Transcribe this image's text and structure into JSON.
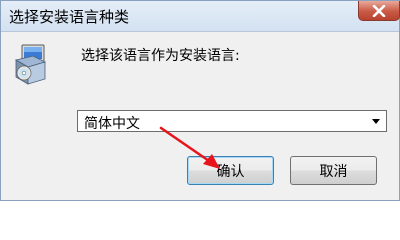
{
  "window": {
    "title": "选择安装语言种类",
    "close_icon": "close-icon"
  },
  "dialog": {
    "icon": "installer-package-icon",
    "prompt": "选择该语言作为安装语言:",
    "language_select": {
      "selected": "简体中文"
    },
    "buttons": {
      "ok_label": "确认",
      "cancel_label": "取消"
    }
  },
  "annotation": {
    "arrow_color": "#e8141c"
  }
}
